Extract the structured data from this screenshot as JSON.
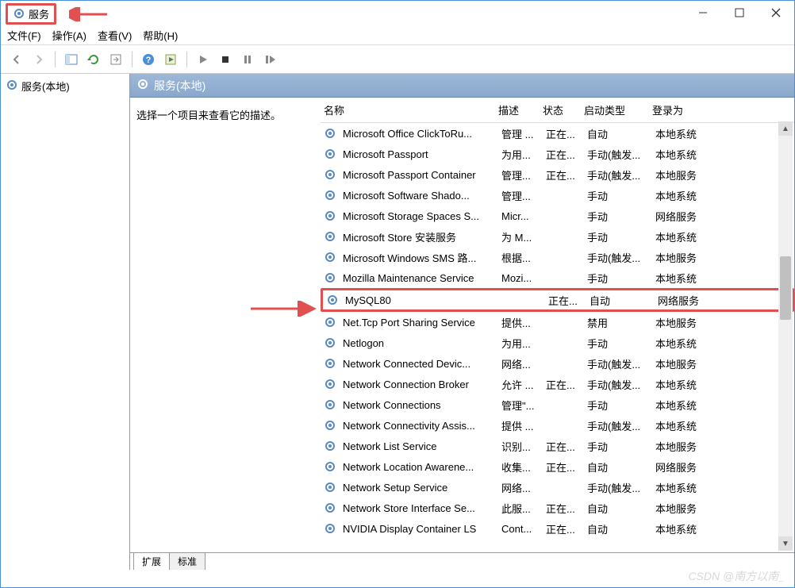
{
  "window": {
    "title": "服务",
    "controls": {
      "min": "minimize",
      "max": "maximize",
      "close": "close"
    }
  },
  "menu": {
    "file": "文件(F)",
    "action": "操作(A)",
    "view": "查看(V)",
    "help": "帮助(H)"
  },
  "tree": {
    "root": "服务(本地)"
  },
  "panel": {
    "header": "服务(本地)",
    "description_prompt": "选择一个项目来查看它的描述。"
  },
  "columns": {
    "name": "名称",
    "desc": "描述",
    "status": "状态",
    "startup": "启动类型",
    "logon": "登录为"
  },
  "services": [
    {
      "name": "Microsoft Office ClickToRu...",
      "desc": "管理 ...",
      "status": "正在...",
      "startup": "自动",
      "logon": "本地系统"
    },
    {
      "name": "Microsoft Passport",
      "desc": "为用...",
      "status": "正在...",
      "startup": "手动(触发...",
      "logon": "本地系统"
    },
    {
      "name": "Microsoft Passport Container",
      "desc": "管理...",
      "status": "正在...",
      "startup": "手动(触发...",
      "logon": "本地服务"
    },
    {
      "name": "Microsoft Software Shado...",
      "desc": "管理...",
      "status": "",
      "startup": "手动",
      "logon": "本地系统"
    },
    {
      "name": "Microsoft Storage Spaces S...",
      "desc": "Micr...",
      "status": "",
      "startup": "手动",
      "logon": "网络服务"
    },
    {
      "name": "Microsoft Store 安装服务",
      "desc": "为 M...",
      "status": "",
      "startup": "手动",
      "logon": "本地系统"
    },
    {
      "name": "Microsoft Windows SMS 路...",
      "desc": "根据...",
      "status": "",
      "startup": "手动(触发...",
      "logon": "本地服务"
    },
    {
      "name": "Mozilla Maintenance Service",
      "desc": "Mozi...",
      "status": "",
      "startup": "手动",
      "logon": "本地系统"
    },
    {
      "name": "MySQL80",
      "desc": "",
      "status": "正在...",
      "startup": "自动",
      "logon": "网络服务",
      "highlight": true
    },
    {
      "name": "Net.Tcp Port Sharing Service",
      "desc": "提供...",
      "status": "",
      "startup": "禁用",
      "logon": "本地服务"
    },
    {
      "name": "Netlogon",
      "desc": "为用...",
      "status": "",
      "startup": "手动",
      "logon": "本地系统"
    },
    {
      "name": "Network Connected Devic...",
      "desc": "网络...",
      "status": "",
      "startup": "手动(触发...",
      "logon": "本地服务"
    },
    {
      "name": "Network Connection Broker",
      "desc": "允许 ...",
      "status": "正在...",
      "startup": "手动(触发...",
      "logon": "本地系统"
    },
    {
      "name": "Network Connections",
      "desc": "管理\"...",
      "status": "",
      "startup": "手动",
      "logon": "本地系统"
    },
    {
      "name": "Network Connectivity Assis...",
      "desc": "提供 ...",
      "status": "",
      "startup": "手动(触发...",
      "logon": "本地系统"
    },
    {
      "name": "Network List Service",
      "desc": "识别...",
      "status": "正在...",
      "startup": "手动",
      "logon": "本地服务"
    },
    {
      "name": "Network Location Awarene...",
      "desc": "收集...",
      "status": "正在...",
      "startup": "自动",
      "logon": "网络服务"
    },
    {
      "name": "Network Setup Service",
      "desc": "网络...",
      "status": "",
      "startup": "手动(触发...",
      "logon": "本地系统"
    },
    {
      "name": "Network Store Interface Se...",
      "desc": "此服...",
      "status": "正在...",
      "startup": "自动",
      "logon": "本地服务"
    },
    {
      "name": "NVIDIA Display Container LS",
      "desc": "Cont...",
      "status": "正在...",
      "startup": "自动",
      "logon": "本地系统"
    }
  ],
  "tabs": {
    "extended": "扩展",
    "standard": "标准"
  },
  "watermark": "CSDN @南方以南_"
}
